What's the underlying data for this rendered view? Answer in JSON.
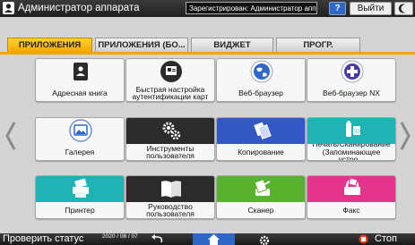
{
  "header": {
    "title": "Администратор аппарата",
    "registration_status": "Зарегистрирован: Администратор аппарат",
    "help_label": "?",
    "logout_label": "Выйти"
  },
  "tabs": [
    {
      "label": "ПРИЛОЖЕНИЯ",
      "active": true
    },
    {
      "label": "ПРИЛОЖЕНИЯ (БО...",
      "active": false
    },
    {
      "label": "ВИДЖЕТ",
      "active": false
    },
    {
      "label": "ПРОГР.",
      "active": false
    }
  ],
  "apps": [
    {
      "label": "Адресная книга",
      "icon": "address-book-icon",
      "color": "#f7f7f7"
    },
    {
      "label": "Быстрая настройка аутентификации карт",
      "icon": "card-auth-icon",
      "color": "#f7f7f7"
    },
    {
      "label": "Веб-браузер",
      "icon": "globe-icon",
      "color": "#f7f7f7"
    },
    {
      "label": "Веб-браузер NX",
      "icon": "browser-nx-icon",
      "color": "#f7f7f7"
    },
    {
      "label": "Галерея",
      "icon": "gallery-icon",
      "color": "#f7f7f7"
    },
    {
      "label": "Инструменты пользователя",
      "icon": "gears-icon",
      "color": "#2b2b2b"
    },
    {
      "label": "Копирование",
      "icon": "copy-icon",
      "color": "#3258c4"
    },
    {
      "label": "Печать/Сканирование (Запоминающее устро...",
      "icon": "usb-sd-icon",
      "color": "#1fb3b3"
    },
    {
      "label": "Принтер",
      "icon": "printer-icon",
      "color": "#1fb3b3"
    },
    {
      "label": "Руководство пользователя",
      "icon": "book-icon",
      "color": "#2b2b2b"
    },
    {
      "label": "Сканер",
      "icon": "scanner-icon",
      "color": "#58b22e"
    },
    {
      "label": "Факс",
      "icon": "fax-icon",
      "color": "#e6338c"
    }
  ],
  "footer": {
    "check_status": "Проверить статус",
    "date": "2020 / 08 / 07",
    "stop_label": "Стоп"
  },
  "colors": {
    "accent": "#f0a800",
    "home": "#2f67c9",
    "stop": "#e8401c"
  }
}
